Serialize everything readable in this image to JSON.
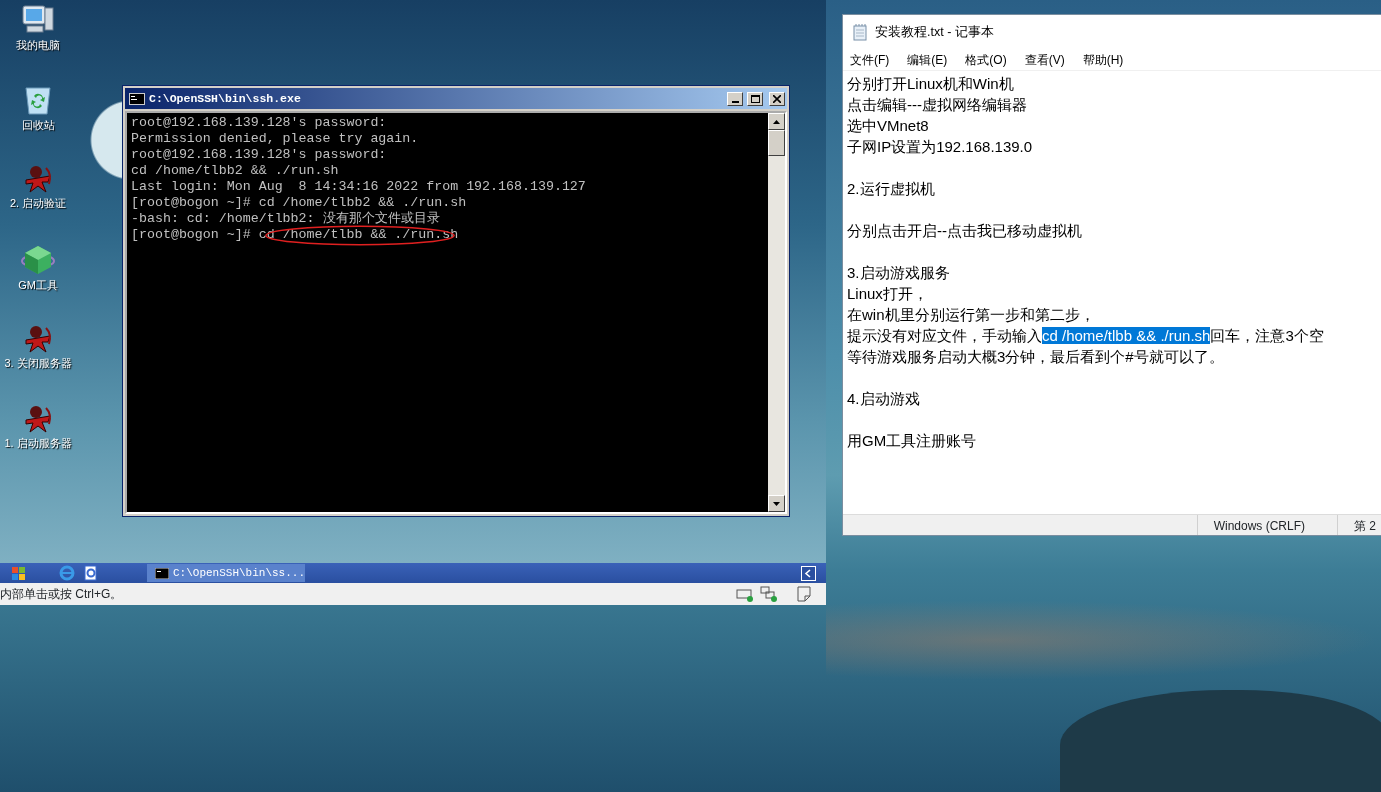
{
  "vm": {
    "desktop_icons": [
      {
        "label": "我的电脑",
        "kind": "computer"
      },
      {
        "label": "回收站",
        "kind": "recycle"
      },
      {
        "label": "2. 启动验证",
        "kind": "game"
      },
      {
        "label": "GM工具",
        "kind": "cube"
      },
      {
        "label": "3. 关闭服务器",
        "kind": "game"
      },
      {
        "label": "1. 启动服务器",
        "kind": "game"
      }
    ],
    "console": {
      "title": "C:\\OpenSSH\\bin\\ssh.exe",
      "lines": [
        "root@192.168.139.128's password:",
        "Permission denied, please try again.",
        "root@192.168.139.128's password:",
        "cd /home/tlbb2 && ./run.sh",
        "Last login: Mon Aug  8 14:34:16 2022 from 192.168.139.127",
        "[root@bogon ~]# cd /home/tlbb2 && ./run.sh",
        "-bash: cd: /home/tlbb2: 没有那个文件或目录"
      ],
      "last_line": {
        "prompt": "[root@bogon ~]#",
        "command": "cd /home/tlbb && ./run.sh",
        "circled": true
      }
    },
    "taskbar": {
      "tasks": [
        {
          "label": "C:\\OpenSSH\\bin\\ss...",
          "selected": true
        }
      ]
    },
    "status_text": "内部单击或按 Ctrl+G。"
  },
  "notepad": {
    "title": "安装教程.txt - 记事本",
    "menu": [
      "文件(F)",
      "编辑(E)",
      "格式(O)",
      "查看(V)",
      "帮助(H)"
    ],
    "blocks": [
      [
        {
          "kind": "plain",
          "text": "分别打开Linux机和Win机"
        },
        {
          "kind": "plain",
          "text": "点击编辑---虚拟网络编辑器"
        },
        {
          "kind": "plain",
          "text": "选中VMnet8"
        },
        {
          "kind": "plain",
          "text": "子网IP设置为192.168.139.0"
        }
      ],
      [
        {
          "kind": "plain",
          "text": "2.运行虚拟机"
        }
      ],
      [
        {
          "kind": "plain",
          "text": "分别点击开启--点击我已移动虚拟机"
        }
      ],
      [
        {
          "kind": "plain",
          "text": "3.启动游戏服务"
        },
        {
          "kind": "plain",
          "text": "Linux打开，"
        },
        {
          "kind": "plain",
          "text": "在win机里分别运行第一步和第二步，"
        },
        {
          "kind": "parts",
          "parts": [
            {
              "text": "提示没有对应文件，手动输入",
              "selected": false
            },
            {
              "text": "cd /home/tlbb && ./run.sh",
              "selected": true
            },
            {
              "text": "回车，注意3个空",
              "selected": false
            }
          ]
        },
        {
          "kind": "plain",
          "text": "等待游戏服务启动大概3分钟，最后看到个#号就可以了。"
        }
      ],
      [
        {
          "kind": "plain",
          "text": "4.启动游戏"
        }
      ],
      [
        {
          "kind": "plain",
          "text": "用GM工具注册账号"
        }
      ]
    ],
    "status": [
      "Windows (CRLF)",
      "第 2"
    ]
  }
}
